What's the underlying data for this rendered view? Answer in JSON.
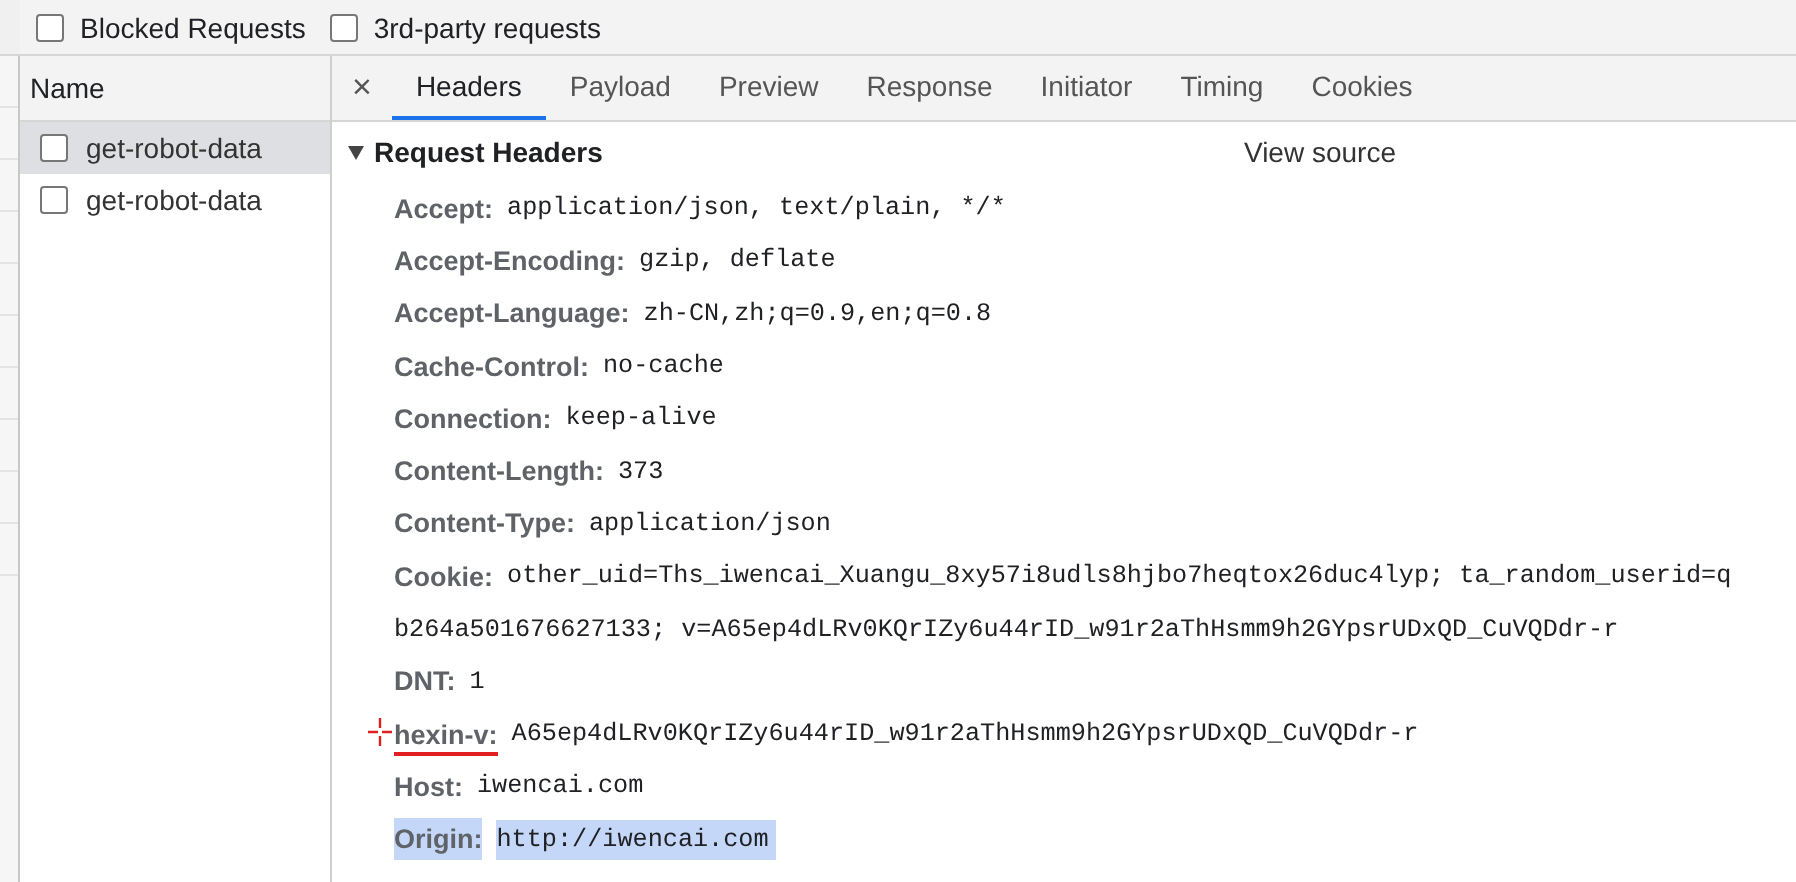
{
  "filters": [
    {
      "label": "Blocked Requests",
      "checked": false
    },
    {
      "label": "3rd-party requests",
      "checked": false
    }
  ],
  "requests": {
    "column": "Name",
    "rows": [
      {
        "name": "get-robot-data",
        "selected": true,
        "checked": false
      },
      {
        "name": "get-robot-data",
        "selected": false,
        "checked": false
      }
    ]
  },
  "close": "×",
  "tabs": [
    {
      "label": "Headers",
      "selected": true
    },
    {
      "label": "Payload",
      "selected": false
    },
    {
      "label": "Preview",
      "selected": false
    },
    {
      "label": "Response",
      "selected": false
    },
    {
      "label": "Initiator",
      "selected": false
    },
    {
      "label": "Timing",
      "selected": false
    },
    {
      "label": "Cookies",
      "selected": false
    }
  ],
  "section": {
    "title": "Request Headers",
    "expanded": true,
    "view_source": "View source"
  },
  "headers": [
    {
      "name": "Accept:",
      "value": "application/json, text/plain, */*",
      "highlighted": false,
      "annotated": false
    },
    {
      "name": "Accept-Encoding:",
      "value": "gzip, deflate",
      "highlighted": false,
      "annotated": false
    },
    {
      "name": "Accept-Language:",
      "value": "zh-CN,zh;q=0.9,en;q=0.8",
      "highlighted": false,
      "annotated": false
    },
    {
      "name": "Cache-Control:",
      "value": "no-cache",
      "highlighted": false,
      "annotated": false
    },
    {
      "name": "Connection:",
      "value": "keep-alive",
      "highlighted": false,
      "annotated": false
    },
    {
      "name": "Content-Length:",
      "value": "373",
      "highlighted": false,
      "annotated": false
    },
    {
      "name": "Content-Type:",
      "value": "application/json",
      "highlighted": false,
      "annotated": false
    },
    {
      "name": "Cookie:",
      "value": "other_uid=Ths_iwencai_Xuangu_8xy57i8udls8hjbo7heqtox26duc4lyp; ta_random_userid=q",
      "continuation": "b264a501676627133; v=A65ep4dLRv0KQrIZy6u44rID_w91r2aThHsmm9h2GYpsrUDxQD_CuVQDdr-r",
      "highlighted": false,
      "annotated": false
    },
    {
      "name": "DNT:",
      "value": "1",
      "highlighted": false,
      "annotated": false
    },
    {
      "name": "hexin-v:",
      "value": "A65ep4dLRv0KQrIZy6u44rID_w91r2aThHsmm9h2GYpsrUDxQD_CuVQDdr-r",
      "highlighted": false,
      "annotated": true
    },
    {
      "name": "Host:",
      "value": "iwencai.com",
      "highlighted": false,
      "annotated": false
    },
    {
      "name": "Origin:",
      "value": "http://iwencai.com",
      "highlighted": true,
      "annotated": false
    }
  ]
}
